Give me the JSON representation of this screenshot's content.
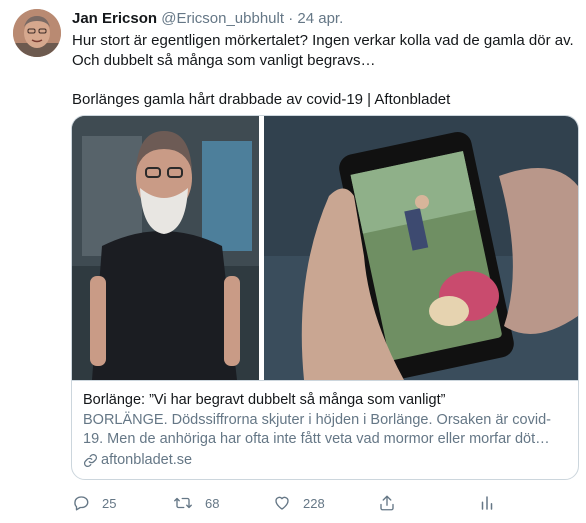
{
  "tweet": {
    "author_name": "Jan Ericson",
    "handle": "@Ericson_ubbhult",
    "separator": "·",
    "date": "24 apr.",
    "text_line1": "Hur stort är egentligen mörkertalet? Ingen verkar kolla vad de gamla dör av.",
    "text_line2": "Och dubbelt så många som vanligt begravs…",
    "text_line3": "Borlänges gamla hårt drabbade av covid-19 | Aftonbladet"
  },
  "card": {
    "title": "Borlänge: ”Vi har begravt dubbelt så många som vanligt”",
    "description": "BORLÄNGE. Dödssiffrorna skjuter i höjden i Borlänge. Orsaken är covid-19. Men de anhöriga har ofta inte fått veta vad mormor eller morfar döt…",
    "domain": "aftonbladet.se"
  },
  "actions": {
    "reply_count": "25",
    "retweet_count": "68",
    "like_count": "228"
  },
  "icons": [
    "reply-icon",
    "retweet-icon",
    "like-icon",
    "analytics-icon",
    "link-icon"
  ]
}
